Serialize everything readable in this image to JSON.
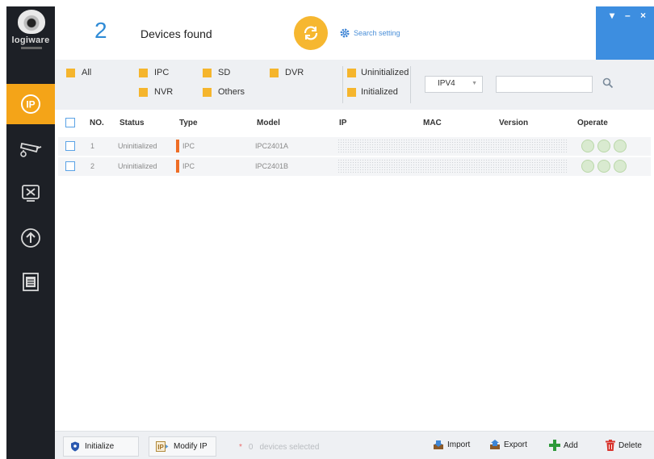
{
  "sidebar": {
    "brand": "logiware",
    "items": [
      {
        "icon": "ip-icon",
        "active": true
      },
      {
        "icon": "camera-icon",
        "active": false
      },
      {
        "icon": "tools-icon",
        "active": false
      },
      {
        "icon": "upgrade-icon",
        "active": false
      },
      {
        "icon": "document-icon",
        "active": false
      }
    ]
  },
  "header": {
    "count": "2",
    "found_label": "Devices found",
    "search_setting": "Search setting"
  },
  "window": {
    "menu": "▾",
    "minimize": "–",
    "close": "×"
  },
  "filters": {
    "all": "All",
    "ipc": "IPC",
    "sd": "SD",
    "dvr": "DVR",
    "nvr": "NVR",
    "others": "Others",
    "uninitialized": "Uninitialized",
    "initialized": "Initialized",
    "ip_version": "IPV4"
  },
  "table": {
    "headers": [
      "NO.",
      "Status",
      "Type",
      "Model",
      "IP",
      "MAC",
      "Version",
      "Operate"
    ],
    "rows": [
      {
        "no": "1",
        "status": "Uninitialized",
        "type": "IPC",
        "model": "IPC2401A"
      },
      {
        "no": "2",
        "status": "Uninitialized",
        "type": "IPC",
        "model": "IPC2401B"
      }
    ]
  },
  "footer": {
    "initialize": "Initialize",
    "modify_ip": "Modify IP",
    "selected_count": "0",
    "selected_label": "devices selected",
    "import": "Import",
    "export": "Export",
    "add": "Add",
    "delete": "Delete"
  },
  "colors": {
    "sidebar_bg": "#1d2026",
    "accent_orange": "#f4a418",
    "count_blue": "#2f8bd6",
    "window_bar_blue": "#3d8ee0",
    "checkbox_yellow": "#f5b52d",
    "type_marker": "#ee6d25"
  }
}
